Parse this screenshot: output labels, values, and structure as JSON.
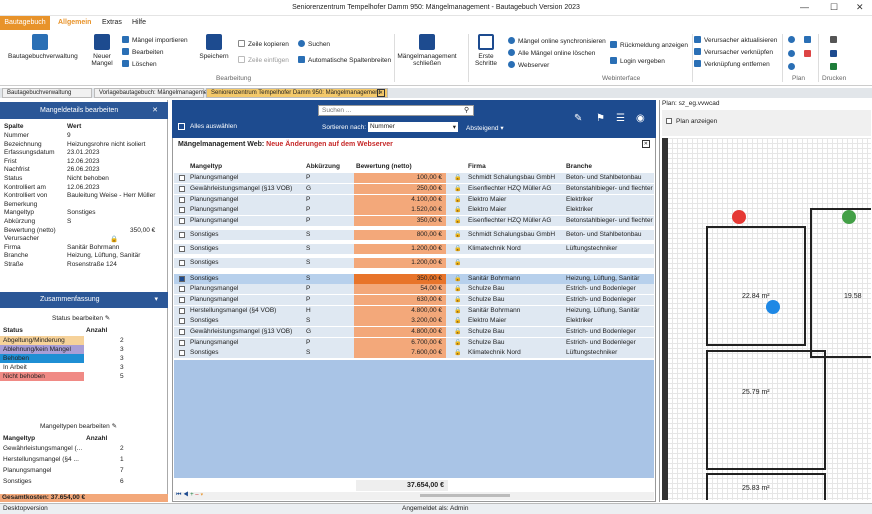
{
  "window": {
    "title": "Seniorenzentrum Tempelhofer Damm 950: Mängelmanagement - Bautagebuch Version 2023"
  },
  "ribbon_tabs": [
    "Bautagebuch",
    "Allgemein",
    "Extras",
    "Hilfe"
  ],
  "ribbon": {
    "btn_bautagebuch": "Bautagebuchverwaltung",
    "btn_neuer": "Neuer Mangel",
    "btn_import": "Mängel importieren",
    "btn_bearbeiten": "Bearbeiten",
    "btn_loeschen": "Löschen",
    "btn_speichern": "Speichern",
    "btn_zeile_kopieren": "Zeile kopieren",
    "btn_zeile_einfuegen": "Zeile einfügen",
    "btn_suchen": "Suchen",
    "btn_spalten": "Automatische Spaltenbreiten",
    "group_bearbeitung": "Bearbeitung",
    "btn_schliessen": "Mängelmanagement schließen",
    "btn_erste": "Erste Schritte",
    "btn_sync": "Mängel online synchronisieren",
    "btn_alle_loeschen": "Alle Mängel online löschen",
    "btn_webserver": "Webserver",
    "btn_rueckmeldung": "Rückmeldung anzeigen",
    "btn_login": "Login vergeben",
    "group_webinterface": "Webinterface",
    "btn_verursacher_akt": "Verursacher aktualisieren",
    "btn_verursacher_verk": "Verursacher verknüpfen",
    "btn_verk_entfernen": "Verknüpfung entfernen",
    "group_plan": "Plan",
    "group_drucken": "Drucken"
  },
  "doc_tabs": [
    "Bautagebuchverwaltung",
    "Vorlagebautagebuch: Mängelmanagement",
    "Seniorenzentrum Tempelhofer Damm 950: Mängelmanagement"
  ],
  "details": {
    "title": "Mangeldetails bearbeiten",
    "col_spalte": "Spalte",
    "col_wert": "Wert",
    "rows": [
      [
        "Nummer",
        "9"
      ],
      [
        "Bezeichnung",
        "Heizungsrohre nicht isoliert"
      ],
      [
        "Erfassungsdatum",
        "23.01.2023"
      ],
      [
        "Frist",
        "12.06.2023"
      ],
      [
        "Nachfrist",
        "26.06.2023"
      ],
      [
        "Status",
        "Nicht behoben"
      ],
      [
        "Kontrolliert am",
        "12.06.2023"
      ],
      [
        "Kontrolliert von",
        "Bauleitung Weise - Herr Müller"
      ],
      [
        "Bemerkung",
        ""
      ],
      [
        "Mangeltyp",
        "Sonstiges"
      ],
      [
        "Abkürzung",
        "S"
      ],
      [
        "Bewertung (netto)",
        "350,00 €"
      ],
      [
        "Verursacher",
        ""
      ],
      [
        "Firma",
        "Sanitär Bohrmann"
      ],
      [
        "Branche",
        "Heizung, Lüftung, Sanitär"
      ],
      [
        "Straße",
        "Rosenstraße 124"
      ]
    ]
  },
  "summary": {
    "title": "Zusammenfassung",
    "status_edit": "Status bearbeiten",
    "col_status": "Status",
    "col_anzahl": "Anzahl",
    "status_rows": [
      {
        "label": "Abgeltung/Minderung",
        "count": "2",
        "color": "#f6d29a"
      },
      {
        "label": "Ablehnung/kein Mangel",
        "count": "3",
        "color": "#a99ed6"
      },
      {
        "label": "Behoben",
        "count": "3",
        "color": "#1f8fd4"
      },
      {
        "label": "In Arbeit",
        "count": "3",
        "color": "#ffffff"
      },
      {
        "label": "Nicht behoben",
        "count": "5",
        "color": "#f08a85"
      }
    ],
    "typ_edit": "Mangeltypen bearbeiten",
    "col_typ": "Mangeltyp",
    "typ_rows": [
      [
        "Gewährleistungsmangel (...",
        "2"
      ],
      [
        "Herstellungsmangel (§4 ...",
        "1"
      ],
      [
        "Planungsmangel",
        "7"
      ],
      [
        "Sonstiges",
        "6"
      ]
    ],
    "total": "Gesamtkosten: 37.654,00 €"
  },
  "filter": {
    "search_placeholder": "Suchen ...",
    "alle_label": "Alles auswählen",
    "sort_label": "Sortieren nach:",
    "sort_value": "Nummer",
    "order": "Absteigend"
  },
  "banner": {
    "prefix": "Mängelmanagement Web: ",
    "highlight": "Neue Änderungen auf dem Webserver"
  },
  "table": {
    "headers": [
      "Mangeltyp",
      "Abkürzung",
      "Bewertung (netto)",
      "Firma",
      "Branche"
    ],
    "rows": [
      [
        "Planungsmangel",
        "P",
        "100,00 €",
        "Schmidt Schalungsbau GmbH",
        "Beton- und Stahlbetonbau"
      ],
      [
        "Gewährleistungsmangel (§13 VOB)",
        "G",
        "250,00 €",
        "Eisenflechter HZQ Müller AG",
        "Betonstahlbieger- und flechter"
      ],
      [
        "Planungsmangel",
        "P",
        "4.100,00 €",
        "Elektro Maier",
        "Elektriker"
      ],
      [
        "Planungsmangel",
        "P",
        "1.520,00 €",
        "Elektro Maier",
        "Elektriker"
      ],
      [
        "Planungsmangel",
        "P",
        "350,00 €",
        "Eisenflechter HZQ Müller AG",
        "Betonstahlbieger- und flechter"
      ],
      [
        "Sonstiges",
        "S",
        "800,00 €",
        "Schmidt Schalungsbau GmbH",
        "Beton- und Stahlbetonbau"
      ],
      [
        "Sonstiges",
        "S",
        "1.200,00 €",
        "Klimatechnik Nord",
        "Lüftungstechniker"
      ],
      [
        "Sonstiges",
        "S",
        "1.200,00 €",
        "",
        ""
      ],
      [
        "Sonstiges",
        "S",
        "350,00 €",
        "Sanitär Bohrmann",
        "Heizung, Lüftung, Sanitär"
      ],
      [
        "Planungsmangel",
        "P",
        "54,00 €",
        "Schulze Bau",
        "Estrich- und Bodenleger"
      ],
      [
        "Planungsmangel",
        "P",
        "630,00 €",
        "Schulze Bau",
        "Estrich- und Bodenleger"
      ],
      [
        "Herstellungsmangel (§4 VOB)",
        "H",
        "4.800,00 €",
        "Sanitär Bohrmann",
        "Heizung, Lüftung, Sanitär"
      ],
      [
        "Sonstiges",
        "S",
        "3.200,00 €",
        "Elektro Maier",
        "Elektriker"
      ],
      [
        "Gewährleistungsmangel (§13 VOB)",
        "G",
        "4.800,00 €",
        "Schulze Bau",
        "Estrich- und Bodenleger"
      ],
      [
        "Planungsmangel",
        "P",
        "6.700,00 €",
        "Schulze Bau",
        "Estrich- und Bodenleger"
      ],
      [
        "Sonstiges",
        "S",
        "7.600,00 €",
        "Klimatechnik Nord",
        "Lüftungstechniker"
      ]
    ],
    "total": "37.654,00 €"
  },
  "plan": {
    "title": "Plan: sz_eg.vvwcad",
    "show_label": "Plan anzeigen",
    "room1": "22.84 m²",
    "room2": "19.58",
    "room3": "25.79 m²",
    "room4": "25.83 m²"
  },
  "statusbar": {
    "left": "Desktopversion",
    "center": "Angemeldet als: Admin"
  }
}
